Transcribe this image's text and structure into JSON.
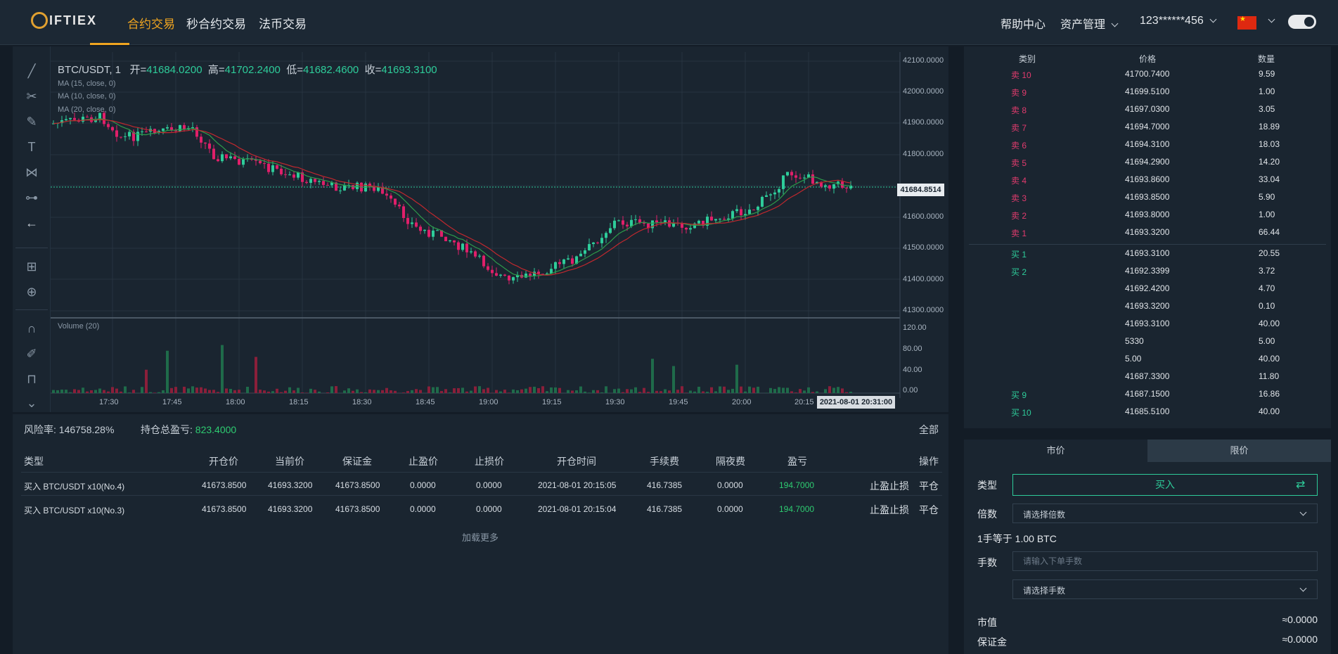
{
  "header": {
    "logo_text": "IFTIEX",
    "nav": [
      "合约交易",
      "秒合约交易",
      "法币交易"
    ],
    "help": "帮助中心",
    "assets": "资产管理",
    "user": "123******456"
  },
  "chart": {
    "symbol": "BTC/USDT, 1",
    "open_label": "开=",
    "open": "41684.0200",
    "high_label": "高=",
    "high": "41702.2400",
    "low_label": "低=",
    "low": "41682.4600",
    "close_label": "收=",
    "close": "41693.3100",
    "ma": [
      "MA (15, close, 0)",
      "MA (10, close, 0)",
      "MA (20, close, 0)"
    ],
    "volume_label": "Volume (20)",
    "price_tag": "41684.8514",
    "time_tag": "2021-08-01 20:31:00",
    "price_ticks": [
      "42100.0000",
      "42000.0000",
      "41900.0000",
      "41800.0000",
      "41600.0000",
      "41500.0000",
      "41400.0000",
      "41300.0000"
    ],
    "volume_ticks": [
      "120.00",
      "80.00",
      "40.00",
      "0.00"
    ],
    "time_ticks": [
      "17:30",
      "17:45",
      "18:00",
      "18:15",
      "18:30",
      "18:45",
      "19:00",
      "19:15",
      "19:30",
      "19:45",
      "20:00",
      "20:15"
    ]
  },
  "positions": {
    "risk_label": "风险率:",
    "risk_value": "146758.28%",
    "pnl_label": "持仓总盈亏:",
    "pnl_value": "823.4000",
    "all_label": "全部",
    "headers": [
      "类型",
      "开仓价",
      "当前价",
      "保证金",
      "止盈价",
      "止损价",
      "开仓时间",
      "手续费",
      "隔夜费",
      "盈亏",
      "操作"
    ],
    "rows": [
      {
        "type": "买入 BTC/USDT x10(No.4)",
        "open": "41673.8500",
        "current": "41693.3200",
        "margin": "41673.8500",
        "tp": "0.0000",
        "sl": "0.0000",
        "time": "2021-08-01 20:15:05",
        "fee": "416.7385",
        "overnight": "0.0000",
        "pnl": "194.7000",
        "action1": "止盈止损",
        "action2": "平仓"
      },
      {
        "type": "买入 BTC/USDT x10(No.3)",
        "open": "41673.8500",
        "current": "41693.3200",
        "margin": "41673.8500",
        "tp": "0.0000",
        "sl": "0.0000",
        "time": "2021-08-01 20:15:04",
        "fee": "416.7385",
        "overnight": "0.0000",
        "pnl": "194.7000",
        "action1": "止盈止损",
        "action2": "平仓"
      }
    ],
    "load_more": "加载更多"
  },
  "orderbook": {
    "headers": [
      "类别",
      "价格",
      "数量"
    ],
    "sells": [
      {
        "label": "卖 10",
        "price": "41700.7400",
        "qty": "9.59"
      },
      {
        "label": "卖 9",
        "price": "41699.5100",
        "qty": "1.00"
      },
      {
        "label": "卖 8",
        "price": "41697.0300",
        "qty": "3.05"
      },
      {
        "label": "卖 7",
        "price": "41694.7000",
        "qty": "18.89"
      },
      {
        "label": "卖 6",
        "price": "41694.3100",
        "qty": "18.03"
      },
      {
        "label": "卖 5",
        "price": "41694.2900",
        "qty": "14.20"
      },
      {
        "label": "卖 4",
        "price": "41693.8600",
        "qty": "33.04"
      },
      {
        "label": "卖 3",
        "price": "41693.8500",
        "qty": "5.90"
      },
      {
        "label": "卖 2",
        "price": "41693.8000",
        "qty": "1.00"
      },
      {
        "label": "卖 1",
        "price": "41693.3200",
        "qty": "66.44"
      }
    ],
    "buys": [
      {
        "label": "买 1",
        "price": "41693.3100",
        "qty": "20.55"
      },
      {
        "label": "买 2",
        "price": "41692.3399",
        "qty": "3.72"
      },
      {
        "label": "",
        "price": "41692.4200",
        "qty": "4.70"
      },
      {
        "label": "",
        "price": "41693.3200",
        "qty": "0.10"
      },
      {
        "label": "",
        "price": "41693.3100",
        "qty": "40.00"
      },
      {
        "label": "",
        "price": "5330",
        "qty": "5.00"
      },
      {
        "label": "",
        "price": "5.00",
        "qty": "40.00"
      },
      {
        "label": "",
        "price": "41687.3300",
        "qty": "11.80"
      },
      {
        "label": "买 9",
        "price": "41687.1500",
        "qty": "16.86"
      },
      {
        "label": "买 10",
        "price": "41685.5100",
        "qty": "40.00"
      }
    ]
  },
  "trade": {
    "tab_market": "市价",
    "tab_limit": "限价",
    "type_label": "类型",
    "type_value": "买入",
    "leverage_label": "倍数",
    "leverage_placeholder": "请选择倍数",
    "lot_note": "1手等于 1.00 BTC",
    "lots_label": "手数",
    "lots_placeholder": "请输入下单手数",
    "lots_select": "请选择手数",
    "market_value_label": "市值",
    "market_value": "≈0.0000",
    "margin_label": "保证金",
    "margin_value": "≈0.0000"
  },
  "colors": {
    "up": "#2ecc9a",
    "down": "#e01f6a",
    "accent": "#f0a520"
  }
}
